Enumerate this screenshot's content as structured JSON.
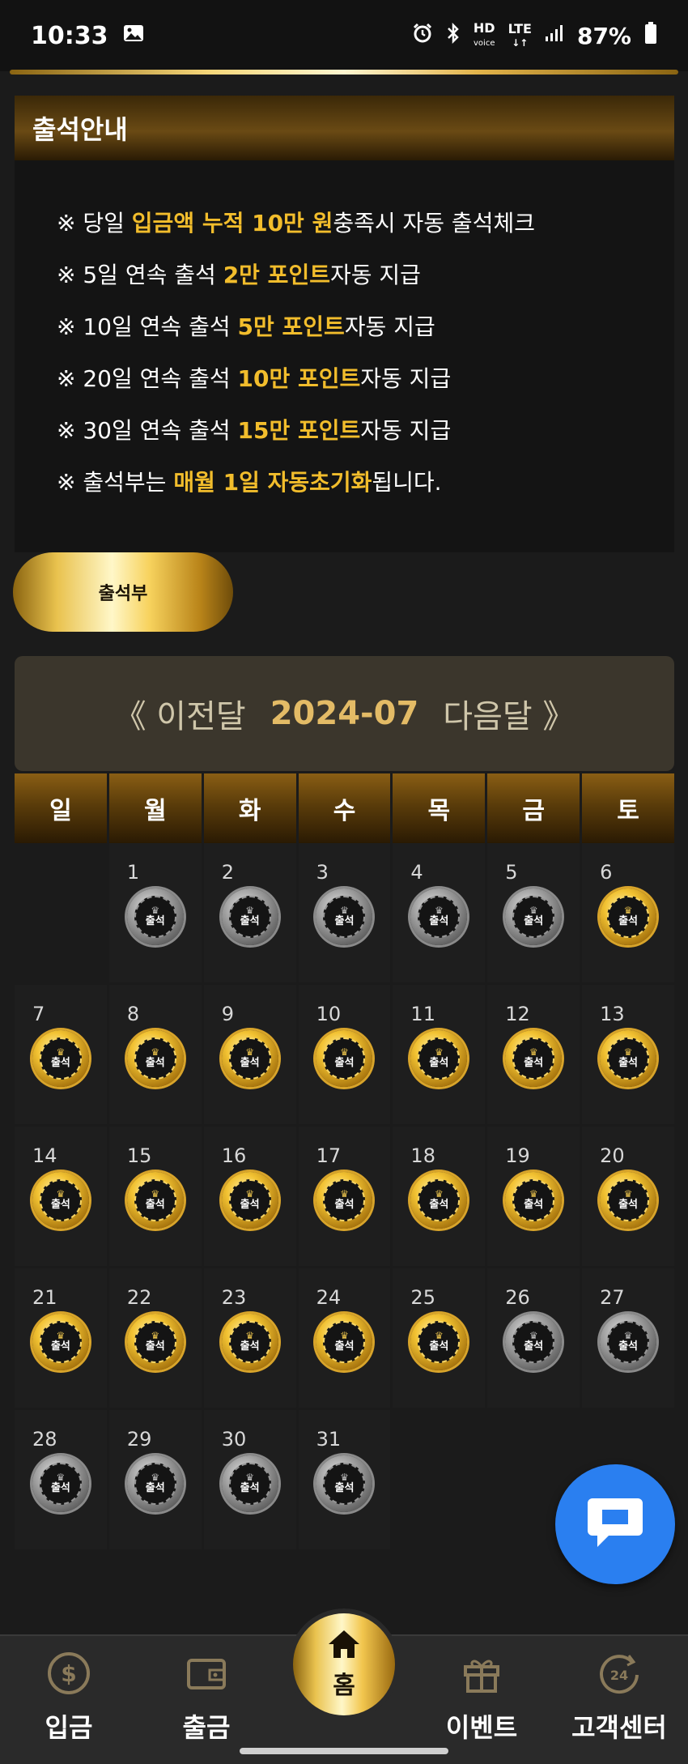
{
  "status_bar": {
    "time": "10:33",
    "hd_label": "HD",
    "voice_label": "voice",
    "lte_label": "LTE",
    "battery": "87%"
  },
  "info": {
    "title": "출석안내",
    "lines": [
      {
        "pre": "※ 당일 ",
        "hl": "입금액 누적 10만 원",
        "post": "충족시 자동 출석체크"
      },
      {
        "pre": "※ 5일 연속 출석 ",
        "hl": "2만 포인트",
        "post": "자동 지급"
      },
      {
        "pre": "※ 10일 연속 출석 ",
        "hl": "5만 포인트",
        "post": "자동 지급"
      },
      {
        "pre": "※ 20일 연속 출석 ",
        "hl": "10만 포인트",
        "post": "자동 지급"
      },
      {
        "pre": "※ 30일 연속 출석 ",
        "hl": "15만 포인트",
        "post": "자동 지급"
      },
      {
        "pre": "※ 출석부는 ",
        "hl": "매월 1일 자동초기화",
        "post": "됩니다."
      }
    ]
  },
  "attend_button": "출석부",
  "month_nav": {
    "prev": "《 이전달",
    "current": "2024-07",
    "next": "다음달 》"
  },
  "weekdays": [
    "일",
    "월",
    "화",
    "수",
    "목",
    "금",
    "토"
  ],
  "calendar": {
    "leading_blanks": 1,
    "stamp_text": "출석",
    "crown_glyph": "♛",
    "days": [
      {
        "day": "1",
        "attended": false
      },
      {
        "day": "2",
        "attended": false
      },
      {
        "day": "3",
        "attended": false
      },
      {
        "day": "4",
        "attended": false
      },
      {
        "day": "5",
        "attended": false
      },
      {
        "day": "6",
        "attended": true
      },
      {
        "day": "7",
        "attended": true
      },
      {
        "day": "8",
        "attended": true
      },
      {
        "day": "9",
        "attended": true
      },
      {
        "day": "10",
        "attended": true
      },
      {
        "day": "11",
        "attended": true
      },
      {
        "day": "12",
        "attended": true
      },
      {
        "day": "13",
        "attended": true
      },
      {
        "day": "14",
        "attended": true
      },
      {
        "day": "15",
        "attended": true
      },
      {
        "day": "16",
        "attended": true
      },
      {
        "day": "17",
        "attended": true
      },
      {
        "day": "18",
        "attended": true
      },
      {
        "day": "19",
        "attended": true
      },
      {
        "day": "20",
        "attended": true
      },
      {
        "day": "21",
        "attended": true
      },
      {
        "day": "22",
        "attended": true
      },
      {
        "day": "23",
        "attended": true
      },
      {
        "day": "24",
        "attended": true
      },
      {
        "day": "25",
        "attended": true
      },
      {
        "day": "26",
        "attended": false
      },
      {
        "day": "27",
        "attended": false
      },
      {
        "day": "28",
        "attended": false
      },
      {
        "day": "29",
        "attended": false
      },
      {
        "day": "30",
        "attended": false
      },
      {
        "day": "31",
        "attended": false
      }
    ]
  },
  "bottom_nav": {
    "deposit": "입금",
    "withdraw": "출금",
    "home": "홈",
    "event": "이벤트",
    "support": "고객센터",
    "support_badge": "24"
  },
  "colors": {
    "gold": "#f2bd2c",
    "accent_blue": "#2a7ff0",
    "background": "#1b1b1b"
  }
}
